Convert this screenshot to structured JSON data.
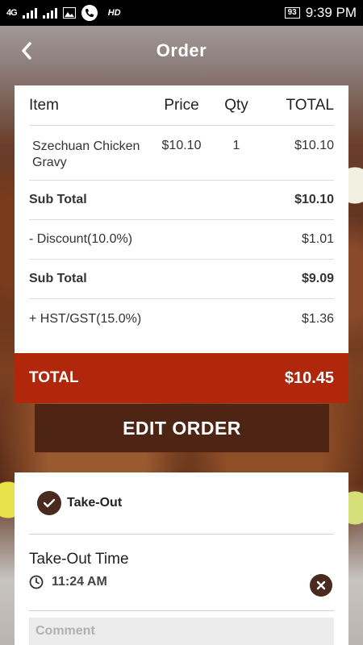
{
  "status_bar": {
    "network": "4G",
    "hd": "HD",
    "battery": "93",
    "time": "9:39 PM"
  },
  "header": {
    "title": "Order",
    "back_icon": "chevron-left-icon"
  },
  "order_table": {
    "columns": [
      "Item",
      "Price",
      "Qty",
      "TOTAL"
    ],
    "items": [
      {
        "name": "Szechuan Chicken Gravy",
        "price": "$10.10",
        "qty": "1",
        "total": "$10.10"
      }
    ],
    "subtotal": {
      "label": "Sub Total",
      "value": "$10.10"
    },
    "discount": {
      "label": "- Discount(10.0%)",
      "value": "$1.01"
    },
    "subtotal_after": {
      "label": "Sub Total",
      "value": "$9.09"
    },
    "tax": {
      "label": "+ HST/GST(15.0%)",
      "value": "$1.36"
    }
  },
  "total": {
    "label": "TOTAL",
    "value": "$10.45"
  },
  "edit_order_label": "EDIT ORDER",
  "order_type": {
    "label": "Take-Out",
    "checked": true
  },
  "takeout_time": {
    "title": "Take-Out Time",
    "value": "11:24 AM"
  },
  "comment": {
    "placeholder": "Comment",
    "value": ""
  },
  "colors": {
    "accent": "#b0270c",
    "dark_brown": "#4e2414",
    "icon_brown": "#4a2a1e"
  }
}
